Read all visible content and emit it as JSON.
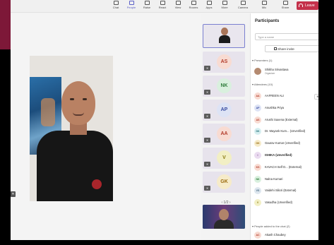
{
  "toolbar": {
    "items": [
      {
        "label": "Chat"
      },
      {
        "label": "People"
      },
      {
        "label": "Raise"
      },
      {
        "label": "React"
      },
      {
        "label": "View"
      },
      {
        "label": "Rooms"
      },
      {
        "label": "Apps"
      },
      {
        "label": "More"
      },
      {
        "label": "Camera"
      },
      {
        "label": "Mic"
      },
      {
        "label": "Share"
      }
    ],
    "leave_label": "Leave"
  },
  "tiles": [
    {
      "initials": "AS",
      "bg": "#f8dbd2",
      "fg": "#b23b2a"
    },
    {
      "initials": "NK",
      "bg": "#d9f0de",
      "fg": "#2f7d3c"
    },
    {
      "initials": "AP",
      "bg": "#dde3f5",
      "fg": "#3a4ea3"
    },
    {
      "initials": "AA",
      "bg": "#f8dbd2",
      "fg": "#b23b2a"
    },
    {
      "initials": "V",
      "bg": "#f2efc4",
      "fg": "#8a7a11"
    },
    {
      "initials": "GK",
      "bg": "#f6ebc9",
      "fg": "#9a6a0d"
    }
  ],
  "pager": "‹  1/2  ›",
  "panel": {
    "title": "Participants",
    "search_placeholder": "Type a name",
    "invite_label": "Share invite",
    "presenters_header": "Presenters (1)",
    "presenter": {
      "name": "Shikha Srivastava",
      "role": "Organizer"
    },
    "attendees_header": "Attendees (10)",
    "mute_label": "Mu",
    "attendees": [
      {
        "initials": "AA",
        "name": "AAFREEN ALI",
        "bg": "#f8dbd2",
        "fg": "#b23b2a",
        "bold": false
      },
      {
        "initials": "AP",
        "name": "Anushka Priya",
        "bg": "#dde3f5",
        "fg": "#3a4ea3",
        "bold": false
      },
      {
        "initials": "AS",
        "name": "Arushi Saxena (External)",
        "bg": "#f8dbd2",
        "fg": "#b23b2a",
        "bold": false
      },
      {
        "initials": "DK",
        "name": "Dr. Mayank Kum... (Unverified)",
        "bg": "#d6eef0",
        "fg": "#26727a",
        "bold": false
      },
      {
        "initials": "GK",
        "name": "Gaurav Kumar (Unverified)",
        "bg": "#f6ebc9",
        "fg": "#9a6a0d",
        "bold": false
      },
      {
        "initials": "I",
        "name": "ISHIKA (Unverified)",
        "bg": "#eadcf0",
        "fg": "#7a3c91",
        "bold": true
      },
      {
        "initials": "KS",
        "name": "KAVACH Self D... (External)",
        "bg": "#f8dbd2",
        "fg": "#b23b2a",
        "bold": false
      },
      {
        "initials": "NK",
        "name": "Nalna Kumari",
        "bg": "#d9f0de",
        "fg": "#2f7d3c",
        "bold": false
      },
      {
        "initials": "VS",
        "name": "Vaidehi Siliori (External)",
        "bg": "#dde6ee",
        "fg": "#42667f",
        "bold": false
      },
      {
        "initials": "V",
        "name": "Vasudha (Unverified)",
        "bg": "#f2efc4",
        "fg": "#8a7a11",
        "bold": false
      }
    ],
    "added_header": "People added to the chat (2)",
    "added": [
      {
        "initials": "AC",
        "name": "Akash Chaubey",
        "bg": "#f8dbd2",
        "fg": "#b23b2a"
      }
    ]
  }
}
